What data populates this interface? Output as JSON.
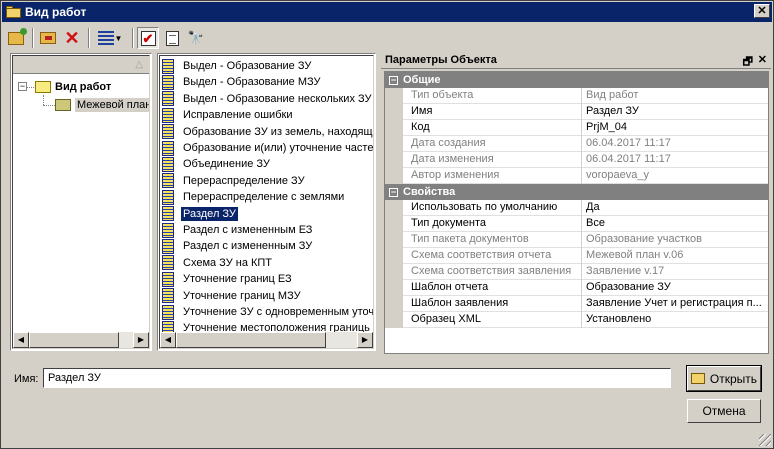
{
  "window": {
    "title": "Вид работ"
  },
  "tree": {
    "root_label": "Вид работ",
    "child_label": "Межевой план"
  },
  "work_list": {
    "items": [
      "Выдел - Образование ЗУ",
      "Выдел - Образование МЗУ",
      "Выдел - Образование нескольких ЗУ",
      "Исправление ошибки",
      "Образование ЗУ из земель, находящ",
      "Образование и(или) уточнение часте",
      "Объединение ЗУ",
      "Перераспределение ЗУ",
      "Перераспределение с землями",
      "Раздел ЗУ",
      "Раздел с измененным ЕЗ",
      "Раздел с измененным ЗУ",
      "Схема ЗУ на КПТ",
      "Уточнение границ ЕЗ",
      "Уточнение границ МЗУ",
      "Уточнение ЗУ с одновременным уточ",
      "Уточнение местоположения границь"
    ],
    "selected_index": 9
  },
  "properties": {
    "title": "Параметры Объекта",
    "categories": [
      {
        "name": "Общие",
        "rows": [
          {
            "name": "Тип объекта",
            "value": "Вид работ",
            "readonly": true
          },
          {
            "name": "Имя",
            "value": "Раздел ЗУ",
            "readonly": false
          },
          {
            "name": "Код",
            "value": "PrjM_04",
            "readonly": false
          },
          {
            "name": "Дата создания",
            "value": "06.04.2017 11:17",
            "readonly": true
          },
          {
            "name": "Дата изменения",
            "value": "06.04.2017 11:17",
            "readonly": true
          },
          {
            "name": "Автор изменения",
            "value": "voropaeva_y",
            "readonly": true
          }
        ]
      },
      {
        "name": "Свойства",
        "rows": [
          {
            "name": "Использовать по умолчанию",
            "value": "Да",
            "readonly": false
          },
          {
            "name": "Тип документа",
            "value": "Все",
            "readonly": false
          },
          {
            "name": "Тип пакета документов",
            "value": "Образование участков",
            "readonly": true
          },
          {
            "name": "Схема соответствия отчета",
            "value": "Межевой план v.06",
            "readonly": true
          },
          {
            "name": "Схема соответствия заявления",
            "value": "Заявление v.17",
            "readonly": true
          },
          {
            "name": "Шаблон отчета",
            "value": "Образование ЗУ",
            "readonly": false
          },
          {
            "name": "Шаблон заявления",
            "value": "Заявление Учет и регистрация п...",
            "readonly": false
          },
          {
            "name": "Образец XML",
            "value": "Установлено",
            "readonly": false
          }
        ]
      }
    ]
  },
  "footer": {
    "name_label": "Имя:",
    "name_value": "Раздел ЗУ",
    "open_label": "Открыть",
    "cancel_label": "Отмена"
  },
  "colors": {
    "titlebar": "#0a246a",
    "selection": "#0a246a",
    "category": "#808080",
    "face": "#d4d0c8"
  }
}
